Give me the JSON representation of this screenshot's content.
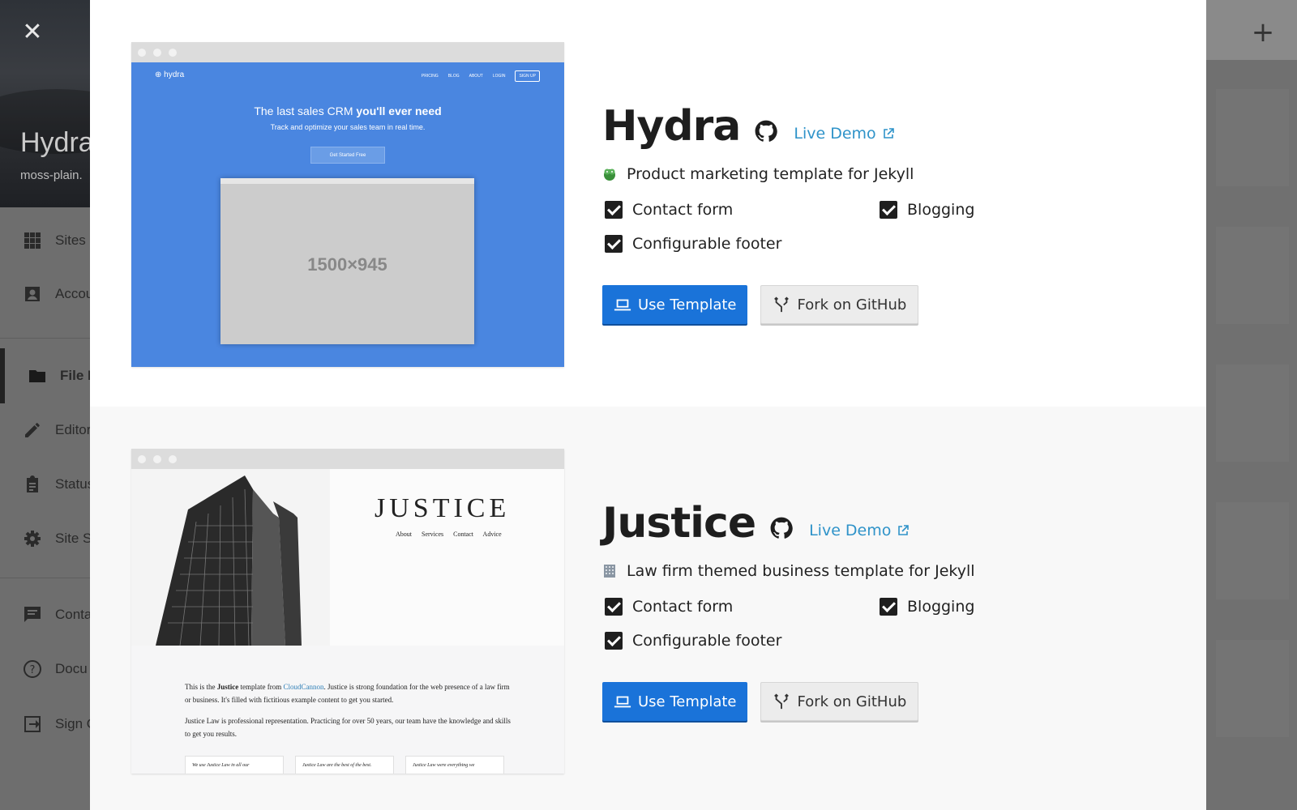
{
  "sidebar": {
    "close_label": "✕",
    "site_name": "Hydra",
    "site_url": "moss-plain.",
    "items": [
      {
        "label": "Sites",
        "icon": "grid-icon"
      },
      {
        "label": "Accou",
        "icon": "account-icon"
      },
      {
        "label": "File E",
        "icon": "folder-icon",
        "active": true
      },
      {
        "label": "Editor",
        "icon": "pencil-icon"
      },
      {
        "label": "Status",
        "icon": "clipboard-icon"
      },
      {
        "label": "Site S",
        "icon": "gear-icon"
      },
      {
        "label": "Conta",
        "icon": "chat-icon"
      },
      {
        "label": "Docu",
        "icon": "help-icon"
      },
      {
        "label": "Sign O",
        "icon": "sign-out-icon"
      }
    ]
  },
  "topbar": {
    "add_label": "+"
  },
  "templates": [
    {
      "name": "Hydra",
      "demo_label": "Live Demo",
      "description": "Product marketing template for Jekyll",
      "description_icon": "hydra-emoji-icon",
      "features": [
        "Contact form",
        "Blogging",
        "Configurable footer"
      ],
      "use_label": "Use Template",
      "fork_label": "Fork on GitHub",
      "preview": {
        "logo": "hydra",
        "nav": [
          "PRICING",
          "BLOG",
          "ABOUT",
          "LOGIN",
          "SIGN UP"
        ],
        "headline_plain": "The last sales CRM ",
        "headline_bold": "you'll ever need",
        "subline": "Track and optimize your sales team in real time.",
        "cta": "Get Started Free",
        "placeholder": "1500×945",
        "accent": "#4a86e0"
      }
    },
    {
      "name": "Justice",
      "demo_label": "Live Demo",
      "description": "Law firm themed business template for Jekyll",
      "description_icon": "building-emoji-icon",
      "features": [
        "Contact form",
        "Blogging",
        "Configurable footer"
      ],
      "use_label": "Use Template",
      "fork_label": "Fork on GitHub",
      "preview": {
        "title": "JUSTICE",
        "nav": "About Services Contact Advice",
        "p1_a": "This is the ",
        "p1_b": "Justice",
        "p1_c": " template from ",
        "p1_link": "CloudCannon",
        "p1_d": ". Justice is strong foundation for the web presence of a law firm or business. It's filled with fictitious example content to get you started.",
        "p2": "Justice Law is professional representation. Practicing for over 50 years, our team have the knowledge and skills to get you results.",
        "quotes": [
          "We use Justice Law in all our",
          "Justice Law are the best of the best.",
          "Justice Law were everything we"
        ]
      }
    }
  ],
  "colors": {
    "primary": "#1a73d9",
    "link": "#2f93c9"
  }
}
